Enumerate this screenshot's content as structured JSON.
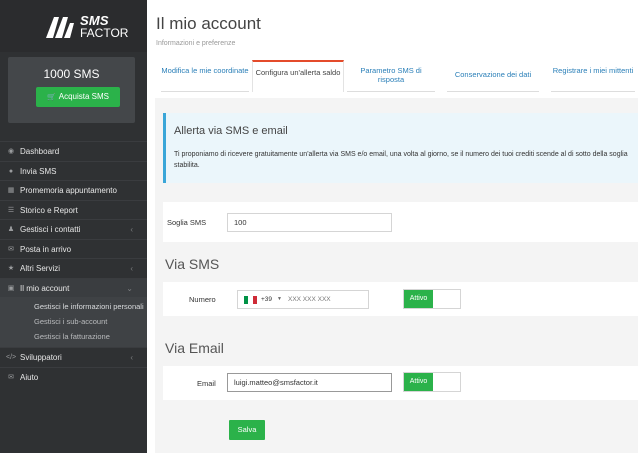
{
  "brand": {
    "logo_top": "SMS",
    "logo_bottom": "FACTOR"
  },
  "credits": {
    "count": "1000 SMS",
    "buy_label": "Acquista SMS"
  },
  "sidebar": {
    "items": [
      {
        "label": "Dashboard",
        "icon": "tachometer-icon"
      },
      {
        "label": "Invia SMS",
        "icon": "chat-icon"
      },
      {
        "label": "Promemoria appuntamento",
        "icon": "calendar-icon"
      },
      {
        "label": "Storico e Report",
        "icon": "list-icon"
      },
      {
        "label": "Gestisci i contatti",
        "icon": "user-icon"
      },
      {
        "label": "Posta in arrivo",
        "icon": "envelope-icon"
      },
      {
        "label": "Altri Servizi",
        "icon": "star-icon"
      },
      {
        "label": "Il mio account",
        "icon": "card-icon"
      }
    ],
    "sub_items": [
      {
        "label": "Gestisci le informazioni personali"
      },
      {
        "label": "Gestisci i sub-account"
      },
      {
        "label": "Gestisci la fatturazione"
      }
    ],
    "items_after": [
      {
        "label": "Sviluppatori",
        "icon": "code-icon"
      },
      {
        "label": "Aiuto",
        "icon": "envelope-icon"
      }
    ]
  },
  "header": {
    "title": "Il mio account",
    "subtitle": "Informazioni e preferenze"
  },
  "tabs": [
    {
      "label": "Modifica le mie coordinate"
    },
    {
      "label": "Configura un'allerta saldo"
    },
    {
      "label": "Parametro SMS di risposta"
    },
    {
      "label": "Conservazione dei dati"
    },
    {
      "label": "Registrare i miei mittenti"
    }
  ],
  "alert": {
    "title": "Allerta via SMS e email",
    "text": "Ti proponiamo di ricevere gratuitamente un'allerta via SMS e/o email, una volta al giorno, se il numero dei tuoi crediti scende al di sotto della soglia stabilita."
  },
  "threshold": {
    "label": "Soglia SMS",
    "value": "100"
  },
  "via_sms": {
    "title": "Via SMS",
    "label": "Numero",
    "prefix": "+39",
    "placeholder": "XXX XXX XXX",
    "toggle_label": "Attivo"
  },
  "via_email": {
    "title": "Via Email",
    "label": "Email",
    "value": "luigi.matteo@smsfactor.it",
    "toggle_label": "Attivo"
  },
  "save_label": "Salva",
  "colors": {
    "accent_green": "#2bb24a",
    "tab_active_border": "#e44b2b",
    "alert_border": "#3aa6d8"
  }
}
